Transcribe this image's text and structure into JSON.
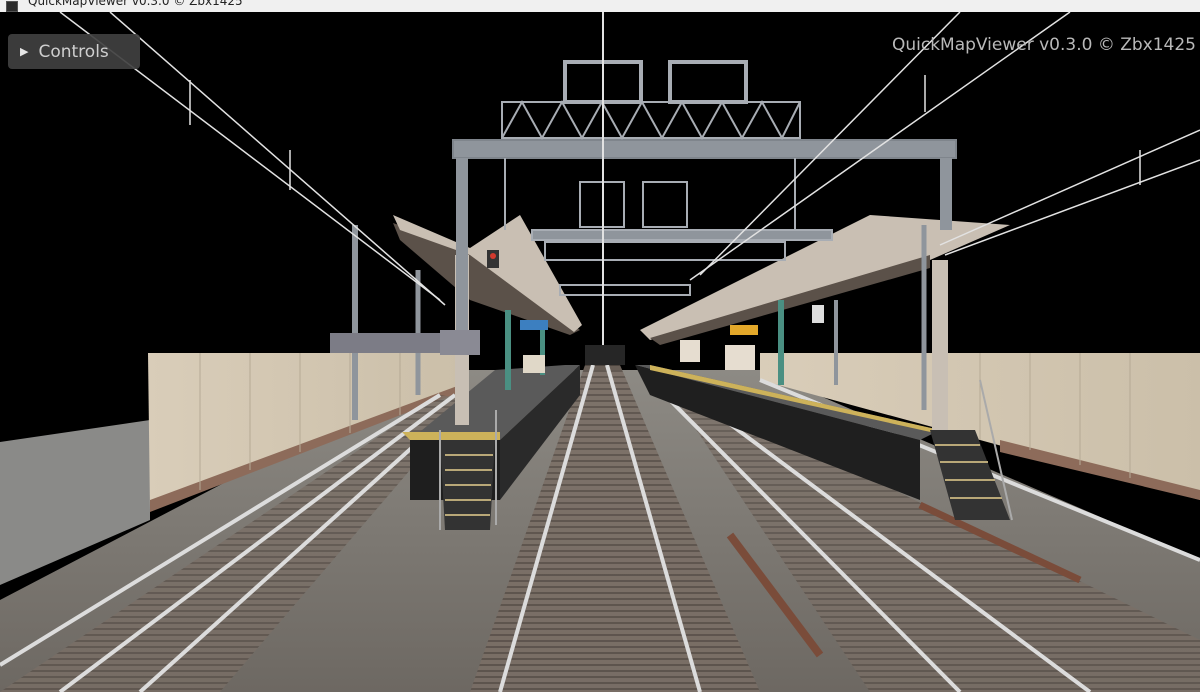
{
  "window": {
    "title": "QuickMapViewer v0.3.0 © Zbx1425"
  },
  "overlay": {
    "controls_label": "Controls",
    "controls_icon": "triangle-right-icon",
    "watermark": "QuickMapViewer v0.3.0 © Zbx1425"
  },
  "scene": {
    "description_icon": "railway-station-3d-view",
    "colors": {
      "sky": "#000000",
      "wall": "#d8cbb8",
      "ballast": "#6f6a63",
      "rail": "#d7d7d7",
      "structure": "#a0a4ab",
      "platform_edge": "#cdb25a"
    }
  }
}
